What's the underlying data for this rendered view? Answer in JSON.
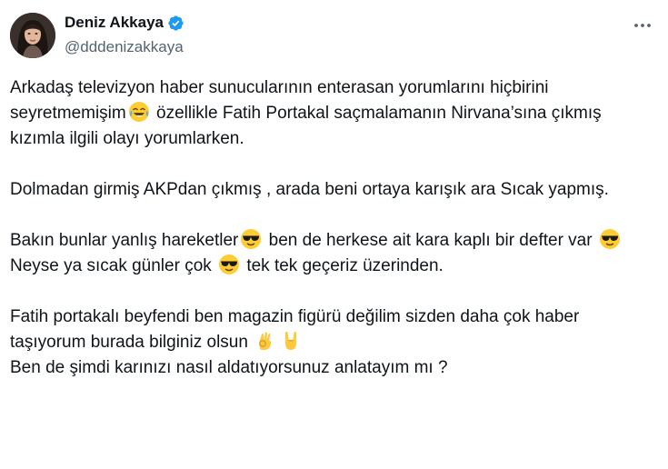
{
  "author": {
    "name": "Deniz Akkaya",
    "handle": "@dddenizakkaya",
    "verified": true,
    "avatar_icon": "profile-photo-icon"
  },
  "menu_icon": "more-options-icon",
  "accent_color": "#1d9bf0",
  "tweet": {
    "p1": {
      "a": "Arkadaş televizyon haber sunucularının enterasan yorumlarını hiçbirini seyretmemişim",
      "emoji1": "face-with-tears-of-joy",
      "b": " özellikle Fatih Portakal saçmalamanın Nirvana’sına çıkmış kızımla ilgili olayı yorumlarken."
    },
    "p2": "Dolmadan girmiş AKPdan çıkmış , arada beni ortaya karışık ara Sıcak yapmış.",
    "p3": {
      "a": "Bakın bunlar yanlış hareketler",
      "emoji1": "sunglasses-face",
      "b": " ben de herkese ait kara kaplı bir defter var ",
      "emoji2": "sunglasses-face"
    },
    "p4": {
      "a": "Neyse ya sıcak günler çok ",
      "emoji1": "sunglasses-face",
      "b": " tek tek geçeriz üzerinden."
    },
    "p5": {
      "a": "Fatih portakalı beyfendi ben magazin figürü değilim sizden daha çok haber taşıyorum burada bilginiz olsun ",
      "emoji1": "ok-hand",
      "emoji2": "rock-on-hand"
    },
    "p6": "Ben de şimdi karınızı nasıl aldatıyorsunuz anlatayım mı ?"
  }
}
